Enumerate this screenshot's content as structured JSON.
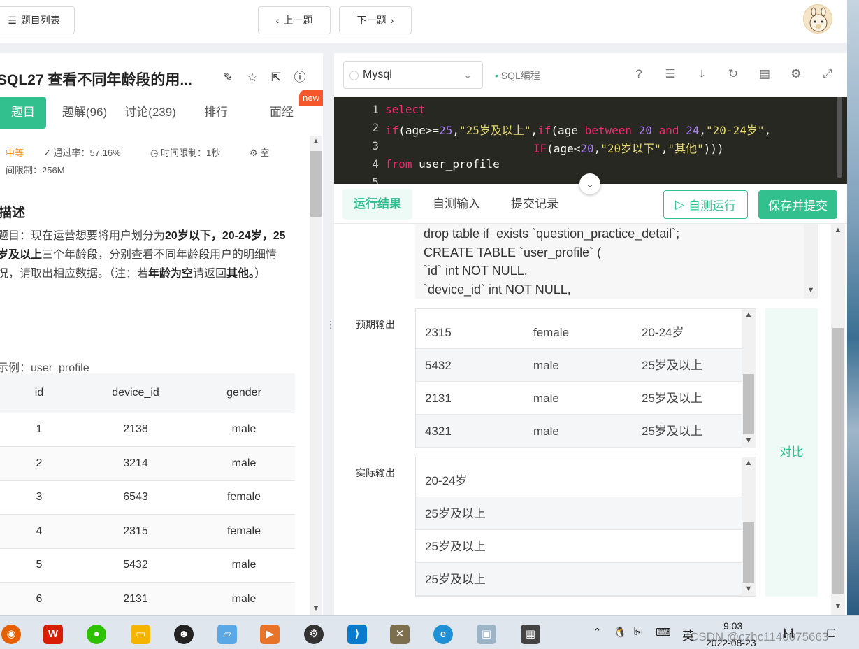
{
  "topbar": {
    "list_label": "题目列表",
    "prev_label": "上一题",
    "next_label": "下一题"
  },
  "problem": {
    "title": "SQL27  查看不同年龄段的用...",
    "new_badge": "new",
    "tabs": [
      "题目",
      "题解(96)",
      "讨论(239)",
      "排行",
      "面经"
    ],
    "difficulty": "中等",
    "pass_rate": "通过率：57.16%",
    "time_limit": "时间限制：1秒",
    "space_limit_a": "空",
    "space_limit_b": "间限制：256M",
    "desc_heading": "描述",
    "desc_text_1": "题目：现在运营想要将用户划分为",
    "desc_bold_1": "20岁以下，20-24岁，25岁及以上",
    "desc_text_2": "三个年龄段，分别查看不同年龄段用户的明细情况，请取出相应数据。（注：若",
    "desc_bold_2": "年龄为空",
    "desc_text_3": "请返回",
    "desc_bold_3": "其他。",
    "desc_text_4": "）",
    "example_label": "示例：user_profile",
    "table": {
      "headers": [
        "id",
        "device_id",
        "gender"
      ],
      "rows": [
        [
          "1",
          "2138",
          "male"
        ],
        [
          "2",
          "3214",
          "male"
        ],
        [
          "3",
          "6543",
          "female"
        ],
        [
          "4",
          "2315",
          "female"
        ],
        [
          "5",
          "5432",
          "male"
        ],
        [
          "6",
          "2131",
          "male"
        ]
      ]
    }
  },
  "editor": {
    "language": "Mysql",
    "mode_label": "SQL编程",
    "line_numbers": [
      "1",
      "2",
      "3",
      "4",
      "5"
    ]
  },
  "result": {
    "tabs": [
      "运行结果",
      "自测输入",
      "提交记录"
    ],
    "run_label": "自测运行",
    "submit_label": "保存并提交",
    "input_text": "drop table if  exists `question_practice_detail`;\nCREATE TABLE `user_profile` (\n`id` int NOT NULL,\n`device_id` int NOT NULL,",
    "expected_label": "预期输出",
    "expected_rows": [
      [
        "2315",
        "female",
        "20-24岁"
      ],
      [
        "5432",
        "male",
        "25岁及以上"
      ],
      [
        "2131",
        "male",
        "25岁及以上"
      ],
      [
        "4321",
        "male",
        "25岁及以上"
      ]
    ],
    "actual_label": "实际输出",
    "actual_rows": [
      "20-24岁",
      "25岁及以上",
      "25岁及以上",
      "25岁及以上"
    ],
    "compare_label": "对比"
  },
  "taskbar": {
    "ime": "英",
    "time": "9:03",
    "date": "2022-08-23",
    "watermark": "CSDN @czhc1140075663"
  }
}
